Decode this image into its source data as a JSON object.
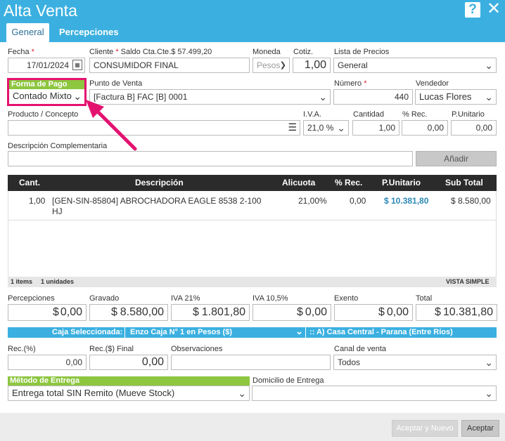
{
  "window": {
    "title": "Alta Venta"
  },
  "tabs": [
    {
      "label": "General"
    },
    {
      "label": "Percepciones"
    }
  ],
  "fecha": {
    "label": "Fecha",
    "value": "17/01/2024"
  },
  "cliente": {
    "label": "Cliente",
    "saldo": "Saldo Cta.Cte.$ 57.499,20",
    "value": "CONSUMIDOR FINAL"
  },
  "moneda": {
    "label": "Moneda",
    "value": "Pesos"
  },
  "cotiz": {
    "label": "Cotiz.",
    "value": "1,00"
  },
  "lista_precios": {
    "label": "Lista de Precios",
    "value": "General"
  },
  "forma_pago": {
    "label": "Forma de Pago",
    "value": "Contado Mixto"
  },
  "punto_venta": {
    "label": "Punto de Venta",
    "value": "[Factura B] FAC [B] 0001"
  },
  "numero": {
    "label": "Número",
    "value": "440"
  },
  "vendedor": {
    "label": "Vendedor",
    "value": "Lucas Flores"
  },
  "producto": {
    "label": "Producto / Concepto",
    "value": ""
  },
  "iva": {
    "label": "I.V.A.",
    "value": "21,0 %"
  },
  "cantidad": {
    "label": "Cantidad",
    "value": "1,00"
  },
  "rec": {
    "label": "% Rec.",
    "value": "0,00"
  },
  "punitario": {
    "label": "P.Unitario",
    "value": "0,00"
  },
  "desc_comp": {
    "label": "Descripción Complementaria",
    "value": ""
  },
  "anadir_label": "Añadir",
  "grid": {
    "headers": [
      "Cant.",
      "Descripción",
      "Alicuota",
      "% Rec.",
      "P.Unitario",
      "Sub Total"
    ],
    "rows": [
      {
        "cant": "1,00",
        "desc_line1": "[GEN-SIN-85804] ABROCHADORA EAGLE 8538 2-100",
        "desc_line2": "HJ",
        "alicuota": "21,00%",
        "rec": "0,00",
        "punitario": "$ 10.381,80",
        "subtotal": "$ 8.580,00"
      }
    ],
    "footer": {
      "items": "1 items",
      "unidades": "1 unidades",
      "vista": "VISTA SIMPLE"
    }
  },
  "totales": {
    "percepciones": {
      "label": "Percepciones",
      "cur": "$",
      "value": "0,00"
    },
    "gravado": {
      "label": "Gravado",
      "cur": "$",
      "value": "8.580,00"
    },
    "iva21": {
      "label": "IVA 21%",
      "cur": "$",
      "value": "1.801,80"
    },
    "iva105": {
      "label": "IVA 10,5%",
      "cur": "$",
      "value": "0,00"
    },
    "exento": {
      "label": "Exento",
      "cur": "$",
      "value": "0,00"
    },
    "total": {
      "label": "Total",
      "cur": "$",
      "value": "10.381,80"
    }
  },
  "caja": {
    "label": "Caja Seleccionada:",
    "value": "Enzo Caja N° 1 en Pesos ($)",
    "sucursal": ":: A) Casa Central - Parana (Entre Ríos)"
  },
  "rec_pct": {
    "label": "Rec.(%)",
    "value": "0,00"
  },
  "rec_final": {
    "label": "Rec.($) Final",
    "value": "0,00"
  },
  "observaciones": {
    "label": "Observaciones",
    "value": ""
  },
  "canal_venta": {
    "label": "Canal de venta",
    "value": "Todos"
  },
  "metodo_entrega": {
    "label": "Método de Entrega",
    "value": "Entrega total SIN Remito (Mueve Stock)"
  },
  "domicilio": {
    "label": "Domicilio de Entrega",
    "value": ""
  },
  "buttons": {
    "aceptar_nuevo": "Aceptar y Nuevo",
    "aceptar": "Aceptar"
  },
  "colors": {
    "header": "#3bb0e0",
    "accent_green": "#8dc63f",
    "highlight": "#e4126f",
    "price_blue": "#2a88b5"
  }
}
